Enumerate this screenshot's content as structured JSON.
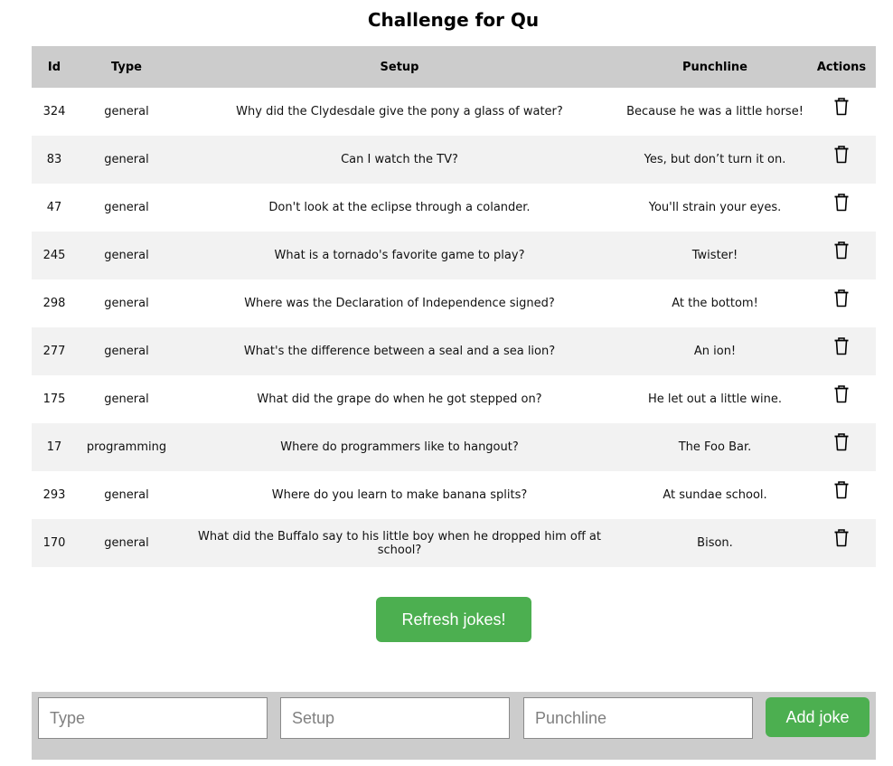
{
  "page": {
    "title": "Challenge for Qu"
  },
  "table": {
    "headers": [
      "Id",
      "Type",
      "Setup",
      "Punchline",
      "Actions"
    ],
    "rows": [
      {
        "id": "324",
        "type": "general",
        "setup": "Why did the Clydesdale give the pony a glass of water?",
        "punchline": "Because he was a little horse!"
      },
      {
        "id": "83",
        "type": "general",
        "setup": "Can I watch the TV?",
        "punchline": "Yes, but don’t turn it on."
      },
      {
        "id": "47",
        "type": "general",
        "setup": "Don't look at the eclipse through a colander.",
        "punchline": "You'll strain your eyes."
      },
      {
        "id": "245",
        "type": "general",
        "setup": "What is a tornado's favorite game to play?",
        "punchline": "Twister!"
      },
      {
        "id": "298",
        "type": "general",
        "setup": "Where was the Declaration of Independence signed?",
        "punchline": "At the bottom!"
      },
      {
        "id": "277",
        "type": "general",
        "setup": "What's the difference between a seal and a sea lion?",
        "punchline": "An ion!"
      },
      {
        "id": "175",
        "type": "general",
        "setup": "What did the grape do when he got stepped on?",
        "punchline": "He let out a little wine."
      },
      {
        "id": "17",
        "type": "programming",
        "setup": "Where do programmers like to hangout?",
        "punchline": "The Foo Bar."
      },
      {
        "id": "293",
        "type": "general",
        "setup": "Where do you learn to make banana splits?",
        "punchline": "At sundae school."
      },
      {
        "id": "170",
        "type": "general",
        "setup": "What did the Buffalo say to his little boy when he dropped him off at school?",
        "punchline": "Bison."
      }
    ],
    "row_action_icon": "trash-icon"
  },
  "refresh_button": {
    "label": "Refresh jokes!"
  },
  "form": {
    "type_placeholder": "Type",
    "setup_placeholder": "Setup",
    "punchline_placeholder": "Punchline",
    "type_value": "",
    "setup_value": "",
    "punchline_value": "",
    "add_label": "Add joke"
  },
  "colors": {
    "accent": "#4caf50",
    "header_bg": "#cccccc",
    "stripe": "#f2f2f2"
  }
}
